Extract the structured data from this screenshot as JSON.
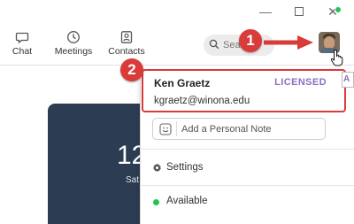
{
  "toolbar": {
    "chat_label": "Chat",
    "meetings_label": "Meetings",
    "contacts_label": "Contacts",
    "search_placeholder": "Search"
  },
  "callouts": {
    "step1": "1",
    "step2": "2"
  },
  "home": {
    "time_partial": "12",
    "date_partial": "Sat"
  },
  "profile_menu": {
    "name": "Ken Graetz",
    "license": "LICENSED",
    "email": "kgraetz@winona.edu",
    "edge_letter": "A",
    "note_placeholder": "Add a Personal Note",
    "settings_label": "Settings",
    "status_label": "Available"
  },
  "colors": {
    "callout_red": "#d93a3a",
    "available_green": "#23c552",
    "licensed_purple": "#8a6fc0"
  }
}
